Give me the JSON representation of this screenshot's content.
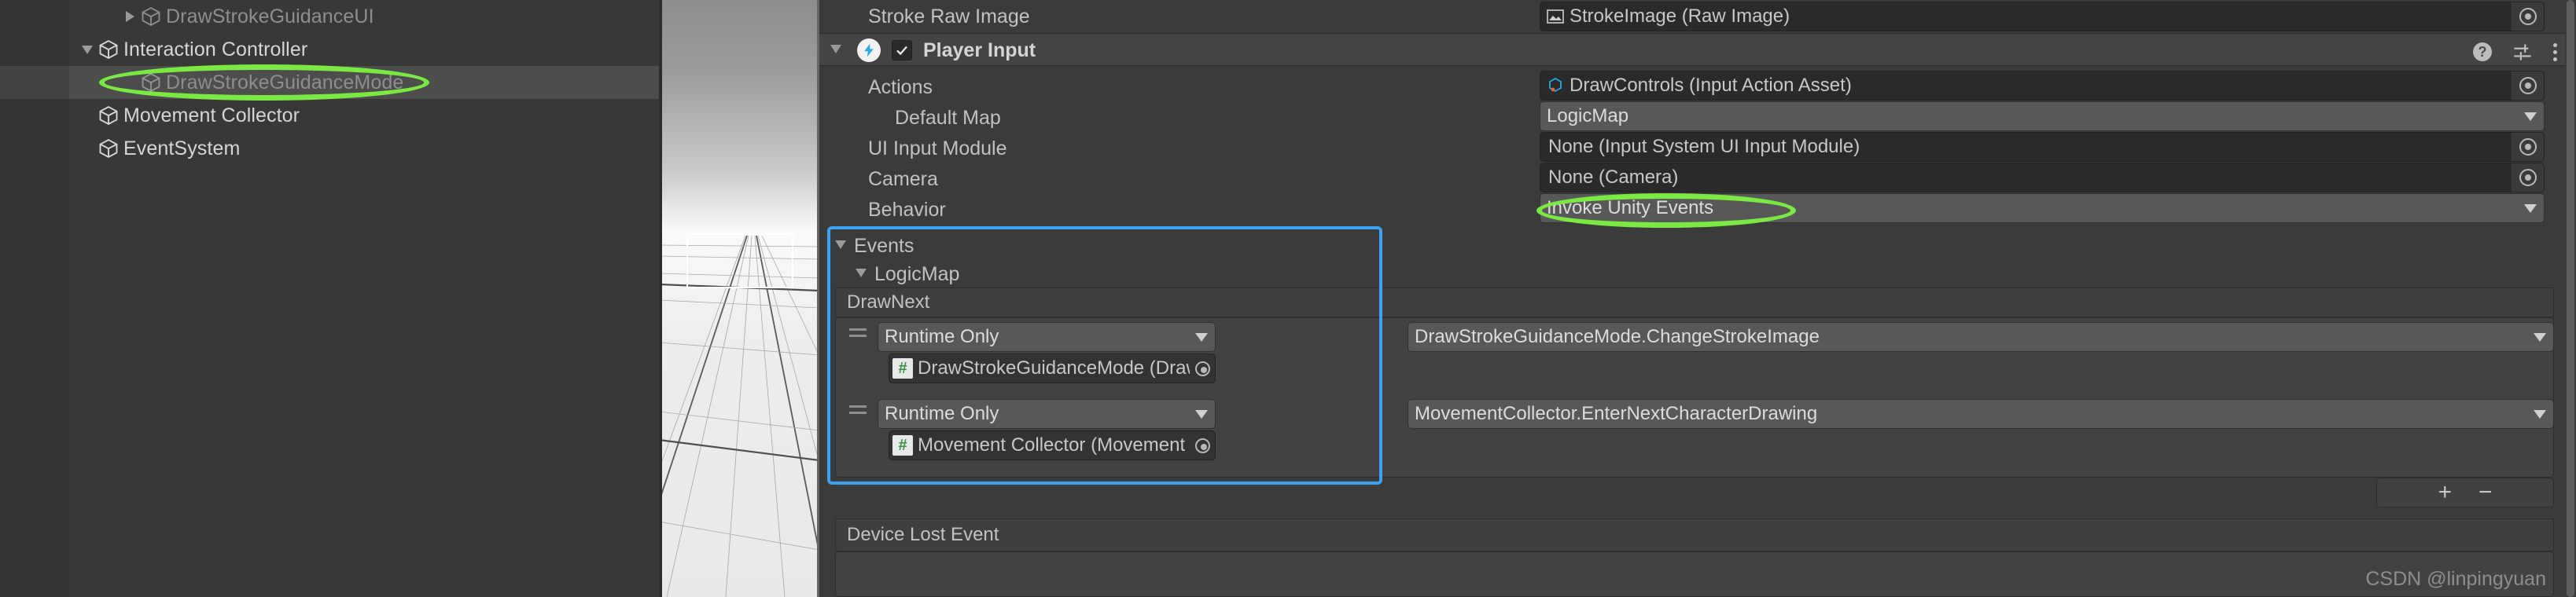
{
  "app": {
    "name": "Unity Editor",
    "watermark": "CSDN @linpingyuan"
  },
  "hierarchy": {
    "items": [
      {
        "label": "DrawStrokeGuidanceUI",
        "indent": 2,
        "foldout": "right",
        "selected": false,
        "dim": true,
        "highlighted": false
      },
      {
        "label": "Interaction Controller",
        "indent": 1,
        "foldout": "down",
        "selected": false,
        "dim": false,
        "highlighted": false
      },
      {
        "label": "DrawStrokeGuidanceMode",
        "indent": 2,
        "foldout": "none",
        "selected": true,
        "dim": true,
        "highlighted": true
      },
      {
        "label": "Movement Collector",
        "indent": 1,
        "foldout": "none",
        "selected": false,
        "dim": false,
        "highlighted": false
      },
      {
        "label": "EventSystem",
        "indent": 1,
        "foldout": "none",
        "selected": false,
        "dim": false,
        "highlighted": false
      }
    ],
    "icon": "gameobject-cube-icon"
  },
  "scene_view": {
    "name": "scene-view",
    "grid": "perspective-grid",
    "selection_outline": "white-rect-gizmo"
  },
  "inspector": {
    "top_row": {
      "label": "Stroke Raw Image",
      "value": "StrokeImage (Raw Image)",
      "value_icon": "raw-image-icon",
      "picker": "object-picker-icon"
    },
    "component": {
      "title": "Player Input",
      "icon": "player-input-bolt-icon",
      "enabled_checkbox": "✓",
      "foldout": "down",
      "header_icons": [
        "help-icon",
        "preset-icon",
        "kebab-menu-icon"
      ]
    },
    "properties": [
      {
        "label": "Actions",
        "indent": 0,
        "kind": "object",
        "value": "DrawControls (Input Action Asset)",
        "value_icon": "input-action-asset-icon"
      },
      {
        "label": "Default Map",
        "indent": 1,
        "kind": "dropdown",
        "value": "LogicMap"
      },
      {
        "label": "UI Input Module",
        "indent": 0,
        "kind": "object",
        "value": "None (Input System UI Input Module)",
        "value_icon": ""
      },
      {
        "label": "Camera",
        "indent": 0,
        "kind": "object",
        "value": "None (Camera)",
        "value_icon": ""
      },
      {
        "label": "Behavior",
        "indent": 0,
        "kind": "dropdown",
        "value": "Invoke Unity Events"
      }
    ],
    "events": {
      "title": "Events",
      "foldout": "down",
      "map": {
        "title": "LogicMap",
        "foldout": "down"
      },
      "action": {
        "title": "DrawNext"
      },
      "entries": [
        {
          "mode": "Runtime Only",
          "target": "DrawStrokeGuidanceMode (Draw Stroke Guidance",
          "target_icon": "script-hash-icon",
          "function": "DrawStrokeGuidanceMode.ChangeStrokeImage"
        },
        {
          "mode": "Runtime Only",
          "target": "Movement Collector (Movement Collector)",
          "target_icon": "script-hash-icon",
          "function": "MovementCollector.EnterNextCharacterDrawing"
        }
      ],
      "add_label": "+",
      "remove_label": "−"
    },
    "device_lost_event": {
      "title": "Device Lost Event"
    }
  },
  "annotations": {
    "colors": {
      "circle": "#7CE843",
      "selection_box": "#3EA2F0"
    },
    "ellipses": [
      {
        "name": "hierarchy-selected-highlight",
        "target": "DrawStrokeGuidanceMode"
      },
      {
        "name": "behavior-value-highlight",
        "target": "Invoke Unity Events"
      }
    ]
  }
}
